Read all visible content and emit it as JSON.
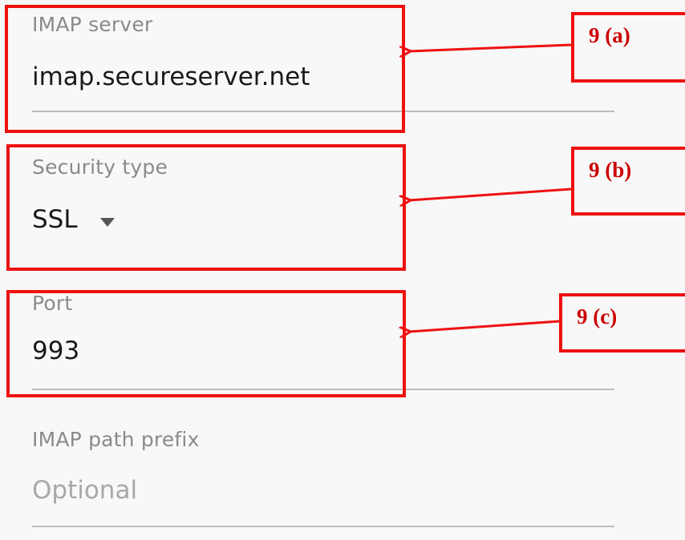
{
  "fields": {
    "imap_server": {
      "label": "IMAP server",
      "value": "imap.secureserver.net"
    },
    "security_type": {
      "label": "Security type",
      "value": "SSL",
      "icon": "dropdown-triangle-icon"
    },
    "port": {
      "label": "Port",
      "value": "993"
    },
    "imap_path_prefix": {
      "label": "IMAP path prefix",
      "placeholder": "Optional"
    }
  },
  "annotations": {
    "callout_a": "9 (a)",
    "callout_b": "9 (b)",
    "callout_c": "9 (c)",
    "highlight_color": "#ee1111"
  }
}
